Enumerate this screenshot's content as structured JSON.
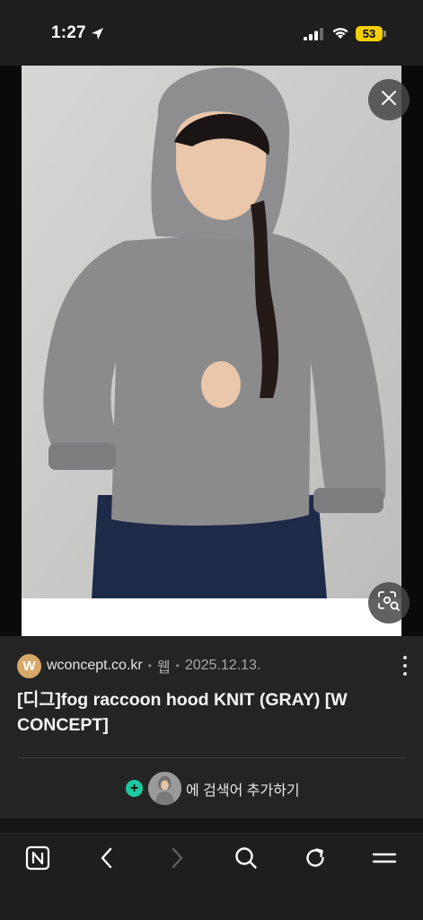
{
  "status_bar": {
    "time": "1:27",
    "battery": "53",
    "icons": [
      "location-arrow-icon",
      "signal-bars-icon",
      "wifi-icon",
      "battery-icon"
    ]
  },
  "viewer": {
    "close_icon": "close-icon",
    "lens_icon": "image-search-icon"
  },
  "result": {
    "favicon_letter": "W",
    "source": "wconcept.co.kr",
    "separator": "•",
    "type": "웹",
    "date": "2025.12.13.",
    "title": "[디그]fog raccoon hood KNIT (GRAY) [W CONCEPT]",
    "more_icon": "more-vertical-icon"
  },
  "add_keyword": {
    "plus": "+",
    "label": "에 검색어 추가하기"
  },
  "bottom_nav": {
    "items": [
      "naver-home-icon",
      "back-icon",
      "forward-icon",
      "search-icon",
      "refresh-icon",
      "menu-icon"
    ]
  },
  "colors": {
    "background": "#1e1e1e",
    "panel": "#242424",
    "accent_green": "#1ec9a0",
    "battery": "#f5d000",
    "favicon": "#d7a868"
  }
}
